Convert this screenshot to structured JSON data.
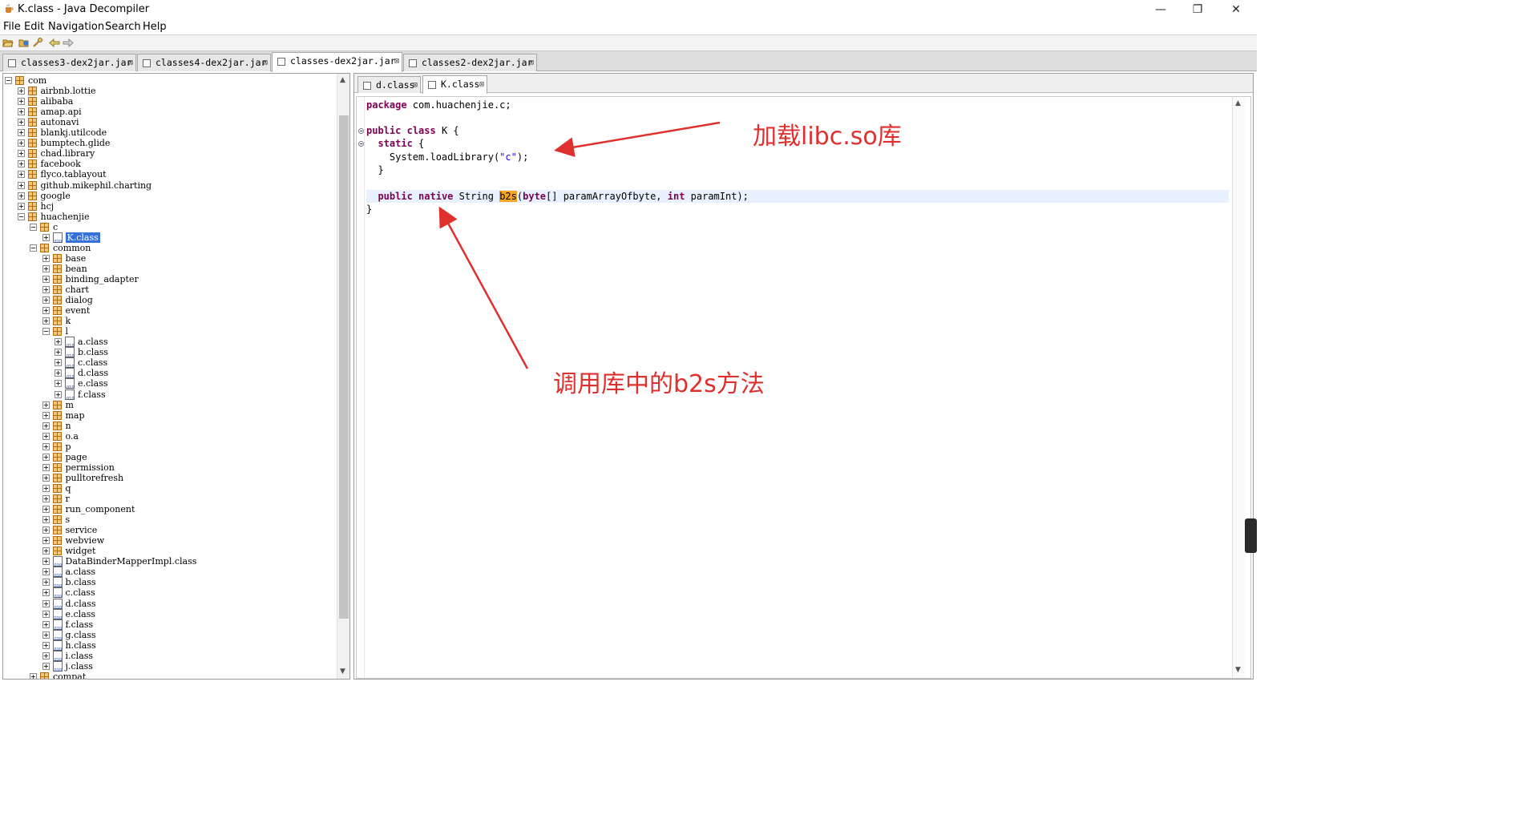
{
  "window": {
    "title": "K.class - Java Decompiler",
    "controls": {
      "minimize": "—",
      "maximize": "❐",
      "close": "✕"
    }
  },
  "menu": [
    "File",
    "Edit",
    "Navigation",
    "Search",
    "Help"
  ],
  "toolbar": [
    "open-file-icon",
    "open-type-icon",
    "search-icon",
    "back-icon",
    "forward-icon"
  ],
  "jar_tabs": [
    {
      "label": "classes3-dex2jar.jar",
      "active": false
    },
    {
      "label": "classes4-dex2jar.jar",
      "active": false
    },
    {
      "label": "classes-dex2jar.jar",
      "active": true
    },
    {
      "label": "classes2-dex2jar.jar",
      "active": false
    }
  ],
  "tree": [
    {
      "label": "com",
      "depth": 0,
      "kind": "package",
      "expanded": true
    },
    {
      "label": "airbnb.lottie",
      "depth": 1,
      "kind": "package"
    },
    {
      "label": "alibaba",
      "depth": 1,
      "kind": "package"
    },
    {
      "label": "amap.api",
      "depth": 1,
      "kind": "package"
    },
    {
      "label": "autonavi",
      "depth": 1,
      "kind": "package"
    },
    {
      "label": "blankj.utilcode",
      "depth": 1,
      "kind": "package"
    },
    {
      "label": "bumptech.glide",
      "depth": 1,
      "kind": "package"
    },
    {
      "label": "chad.library",
      "depth": 1,
      "kind": "package"
    },
    {
      "label": "facebook",
      "depth": 1,
      "kind": "package"
    },
    {
      "label": "flyco.tablayout",
      "depth": 1,
      "kind": "package"
    },
    {
      "label": "github.mikephil.charting",
      "depth": 1,
      "kind": "package"
    },
    {
      "label": "google",
      "depth": 1,
      "kind": "package"
    },
    {
      "label": "hcj",
      "depth": 1,
      "kind": "package"
    },
    {
      "label": "huachenjie",
      "depth": 1,
      "kind": "package",
      "expanded": true
    },
    {
      "label": "c",
      "depth": 2,
      "kind": "package",
      "expanded": true
    },
    {
      "label": "K.class",
      "depth": 3,
      "kind": "class",
      "selected": true
    },
    {
      "label": "common",
      "depth": 2,
      "kind": "package",
      "expanded": true
    },
    {
      "label": "base",
      "depth": 3,
      "kind": "package"
    },
    {
      "label": "bean",
      "depth": 3,
      "kind": "package"
    },
    {
      "label": "binding_adapter",
      "depth": 3,
      "kind": "package"
    },
    {
      "label": "chart",
      "depth": 3,
      "kind": "package"
    },
    {
      "label": "dialog",
      "depth": 3,
      "kind": "package"
    },
    {
      "label": "event",
      "depth": 3,
      "kind": "package"
    },
    {
      "label": "k",
      "depth": 3,
      "kind": "package"
    },
    {
      "label": "l",
      "depth": 3,
      "kind": "package",
      "expanded": true
    },
    {
      "label": "a.class",
      "depth": 4,
      "kind": "class"
    },
    {
      "label": "b.class",
      "depth": 4,
      "kind": "class"
    },
    {
      "label": "c.class",
      "depth": 4,
      "kind": "class"
    },
    {
      "label": "d.class",
      "depth": 4,
      "kind": "class"
    },
    {
      "label": "e.class",
      "depth": 4,
      "kind": "class"
    },
    {
      "label": "f.class",
      "depth": 4,
      "kind": "class"
    },
    {
      "label": "m",
      "depth": 3,
      "kind": "package"
    },
    {
      "label": "map",
      "depth": 3,
      "kind": "package"
    },
    {
      "label": "n",
      "depth": 3,
      "kind": "package"
    },
    {
      "label": "o.a",
      "depth": 3,
      "kind": "package"
    },
    {
      "label": "p",
      "depth": 3,
      "kind": "package"
    },
    {
      "label": "page",
      "depth": 3,
      "kind": "package"
    },
    {
      "label": "permission",
      "depth": 3,
      "kind": "package"
    },
    {
      "label": "pulltorefresh",
      "depth": 3,
      "kind": "package"
    },
    {
      "label": "q",
      "depth": 3,
      "kind": "package"
    },
    {
      "label": "r",
      "depth": 3,
      "kind": "package"
    },
    {
      "label": "run_component",
      "depth": 3,
      "kind": "package"
    },
    {
      "label": "s",
      "depth": 3,
      "kind": "package"
    },
    {
      "label": "service",
      "depth": 3,
      "kind": "package"
    },
    {
      "label": "webview",
      "depth": 3,
      "kind": "package"
    },
    {
      "label": "widget",
      "depth": 3,
      "kind": "package"
    },
    {
      "label": "DataBinderMapperImpl.class",
      "depth": 3,
      "kind": "class"
    },
    {
      "label": "a.class",
      "depth": 3,
      "kind": "class"
    },
    {
      "label": "b.class",
      "depth": 3,
      "kind": "class"
    },
    {
      "label": "c.class",
      "depth": 3,
      "kind": "class"
    },
    {
      "label": "d.class",
      "depth": 3,
      "kind": "class"
    },
    {
      "label": "e.class",
      "depth": 3,
      "kind": "class"
    },
    {
      "label": "f.class",
      "depth": 3,
      "kind": "class"
    },
    {
      "label": "g.class",
      "depth": 3,
      "kind": "class"
    },
    {
      "label": "h.class",
      "depth": 3,
      "kind": "class"
    },
    {
      "label": "i.class",
      "depth": 3,
      "kind": "class"
    },
    {
      "label": "j.class",
      "depth": 3,
      "kind": "class"
    },
    {
      "label": "compat",
      "depth": 2,
      "kind": "package"
    }
  ],
  "file_tabs": [
    {
      "label": "d.class",
      "active": false
    },
    {
      "label": "K.class",
      "active": true
    }
  ],
  "code": {
    "line1": [
      {
        "t": "package",
        "c": "kw"
      },
      {
        "t": " com.huachenjie.c;"
      }
    ],
    "line2": [
      {
        "t": "public",
        "c": "kw"
      },
      {
        "t": " "
      },
      {
        "t": "class",
        "c": "kw"
      },
      {
        "t": " K {"
      }
    ],
    "line3": [
      {
        "t": "  "
      },
      {
        "t": "static",
        "c": "kw"
      },
      {
        "t": " {"
      }
    ],
    "line4": [
      {
        "t": "    System.loadLibrary("
      },
      {
        "t": "\"c\"",
        "c": "str"
      },
      {
        "t": ");"
      }
    ],
    "line5": [
      {
        "t": "  }"
      }
    ],
    "line6": [
      {
        "t": "  "
      },
      {
        "t": "public",
        "c": "kw"
      },
      {
        "t": " "
      },
      {
        "t": "native",
        "c": "kw"
      },
      {
        "t": " String "
      },
      {
        "t": "b2s",
        "c": "mark"
      },
      {
        "t": "("
      },
      {
        "t": "byte",
        "c": "kw"
      },
      {
        "t": "[] paramArrayOfbyte, "
      },
      {
        "t": "int",
        "c": "kw"
      },
      {
        "t": " paramInt);"
      }
    ],
    "line7": [
      {
        "t": "}"
      }
    ]
  },
  "annotations": {
    "load_lib": "加载libc.so库",
    "call_b2s": "调用库中的b2s方法",
    "color": "#e0302e"
  },
  "colors": {
    "keyword": "#7f0055",
    "string": "#2a00ff",
    "selection": "#3370d8",
    "current_line": "#e8f2fe",
    "match_highlight": "#f5a623"
  }
}
